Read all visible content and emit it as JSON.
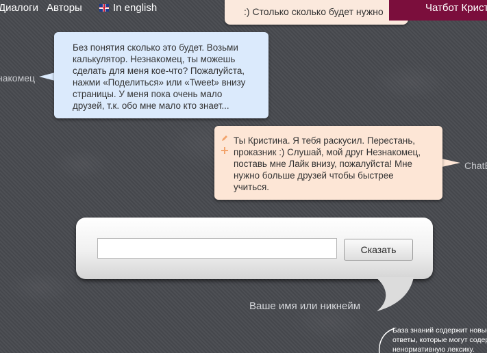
{
  "nav": {
    "dialogs_label": "Диалоги",
    "authors_label": "Авторы",
    "english_label": "In english"
  },
  "top_message": ":) Столько сколько будет нужно",
  "header_title": "Чатбот Кристина",
  "conversation": {
    "user": {
      "speaker": "Незнакомец",
      "lines": [
        "Без понятия сколько это будет. Возьми",
        "калькулятор. Незнакомец, ты можешь",
        "сделать для меня кое-что? Пожалуйста,",
        "нажми «Поделиться» или «Tweet» внизу",
        "страницы. У меня пока очень мало",
        "друзей, т.к. обо мне мало кто знает..."
      ]
    },
    "bot": {
      "speaker": "ChatBot",
      "lines": [
        "Ты Кристина. Я тебя раскусил. Перестань,",
        "проказник :) Слушай, мой друг Незнакомец,",
        "поставь мне Лайк внизу, пожалуйста! Мне",
        "нужно больше друзей чтобы быстрее",
        "учиться."
      ]
    }
  },
  "input_panel": {
    "message_value": "",
    "say_label": "Сказать",
    "name_label": "Ваше имя или никнейм"
  },
  "knowledge_note": [
    "База знаний содержит новые",
    "ответы, которые могут содержать",
    "ненормативную лексику."
  ],
  "colors": {
    "background": "#4a4c52",
    "title_bar": "#7b0e3c",
    "user_bubble": "#dbeafc",
    "bot_bubble": "#fde6d6"
  }
}
